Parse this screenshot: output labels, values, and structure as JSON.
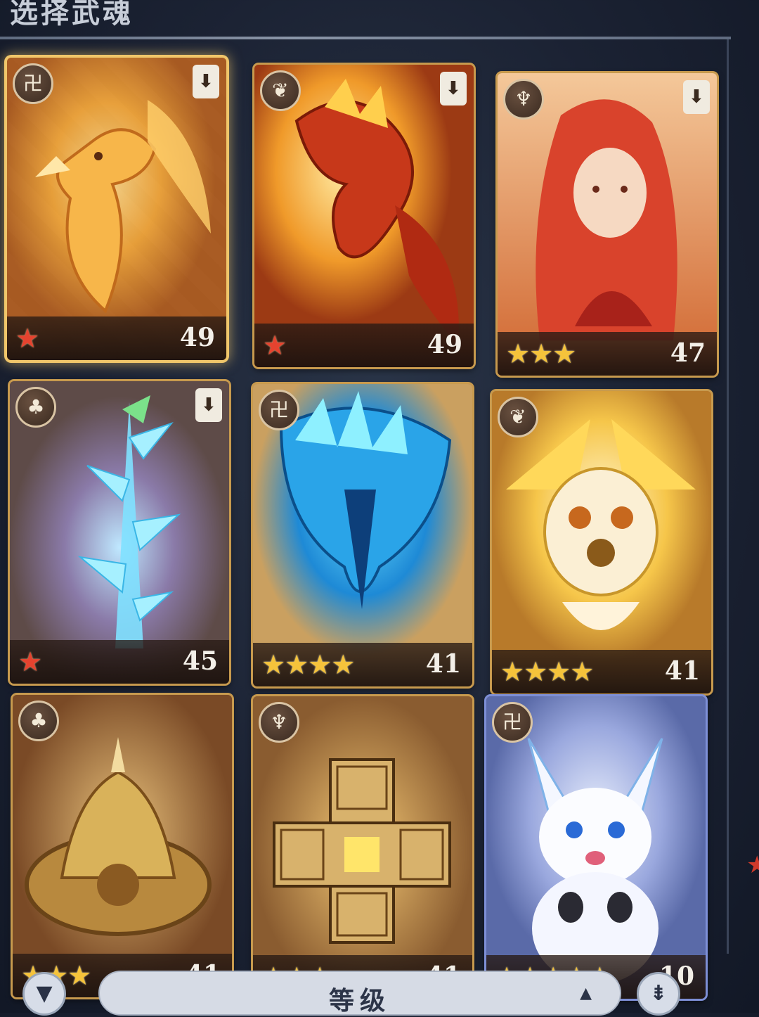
{
  "header": {
    "title": "选择武魂"
  },
  "cards": [
    {
      "type_icon": "tower-icon",
      "type_glyph": "卍",
      "position_icon": "down-arrow-icon",
      "star_count": 1,
      "star_color": "red",
      "level": "49",
      "selected": true,
      "art": "phoenix"
    },
    {
      "type_icon": "wing-icon",
      "type_glyph": "❦",
      "position_icon": "down-arrow-icon",
      "star_count": 1,
      "star_color": "red",
      "level": "49",
      "selected": false,
      "art": "fire-dragon"
    },
    {
      "type_icon": "lotus-icon",
      "type_glyph": "♆",
      "position_icon": "down-arrow-icon",
      "star_count": 3,
      "star_color": "gold",
      "level": "47",
      "selected": false,
      "art": "red-haired-woman"
    },
    {
      "type_icon": "tree-icon",
      "type_glyph": "♣",
      "position_icon": "down-arrow-icon",
      "star_count": 1,
      "star_color": "red",
      "level": "45",
      "selected": false,
      "art": "ice-crystal-plant"
    },
    {
      "type_icon": "tower-icon",
      "type_glyph": "卍",
      "position_icon": "",
      "star_count": 4,
      "star_color": "gold",
      "level": "41",
      "selected": false,
      "art": "ice-dragon"
    },
    {
      "type_icon": "wing-icon",
      "type_glyph": "❦",
      "position_icon": "",
      "star_count": 4,
      "star_color": "gold",
      "level": "41",
      "selected": false,
      "art": "golden-owl"
    },
    {
      "type_icon": "tree-icon",
      "type_glyph": "♣",
      "position_icon": "",
      "star_count": 3,
      "star_color": "gold",
      "level": "41",
      "selected": false,
      "art": "golden-bell"
    },
    {
      "type_icon": "lotus-icon",
      "type_glyph": "♆",
      "position_icon": "",
      "star_count": 3,
      "star_color": "gold",
      "level": "41",
      "selected": false,
      "art": "golden-cube"
    },
    {
      "type_icon": "tower-icon",
      "type_glyph": "卍",
      "position_icon": "",
      "star_count": 5,
      "star_color": "gold",
      "level": "10",
      "selected": false,
      "art": "white-fox"
    }
  ],
  "toolbar": {
    "filter_icon": "filter-icon",
    "sort_label": "等级",
    "sort_chevron_icon": "chevron-up-icon",
    "order_icon": "sort-order-icon"
  },
  "colors": {
    "background": "#1b2233",
    "card_frame": "#c79a4e",
    "star_gold": "#f5c33b",
    "star_red": "#e5432f"
  }
}
